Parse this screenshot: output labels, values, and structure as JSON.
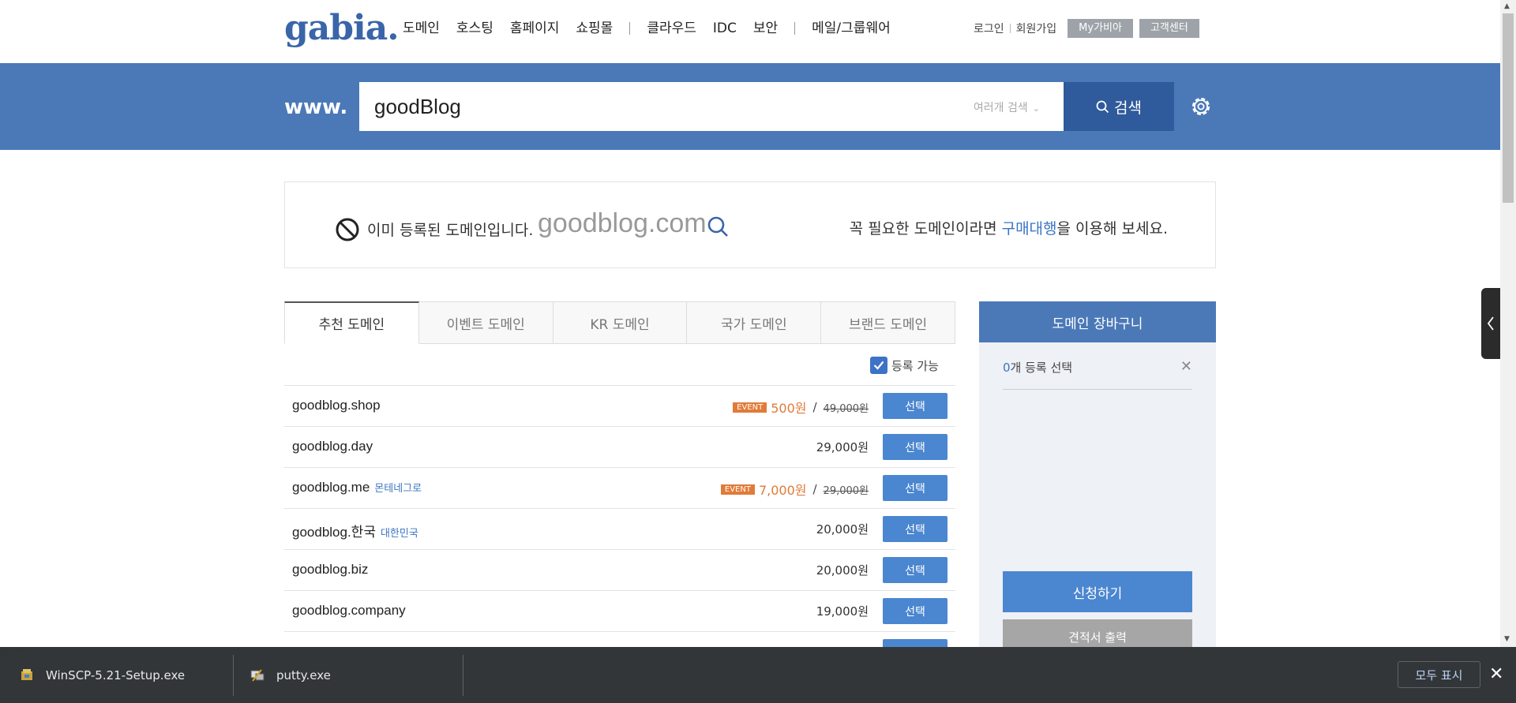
{
  "header": {
    "logo": "gabia.",
    "nav": [
      "도메인",
      "호스팅",
      "홈페이지",
      "쇼핑몰",
      "클라우드",
      "IDC",
      "보안",
      "메일/그룹웨어"
    ],
    "login": "로그인",
    "signup": "회원가입",
    "my_gabia": "My가비아",
    "support": "고객센터"
  },
  "search": {
    "prefix": "www.",
    "query": "goodBlog",
    "multi_search": "여러개 검색",
    "button": "검색"
  },
  "notice": {
    "message": "이미 등록된 도메인입니다.",
    "domain": "goodblog.com",
    "right_prefix": "꼭 필요한 도메인이라면 ",
    "right_link": "구매대행",
    "right_suffix": "을 이용해 보세요."
  },
  "tabs": [
    "추천 도메인",
    "이벤트 도메인",
    "KR 도메인",
    "국가 도메인",
    "브랜드 도메인"
  ],
  "filter": {
    "label": "등록 가능",
    "checked": true
  },
  "domains": [
    {
      "name": "goodblog.shop",
      "country": "",
      "event": "EVENT",
      "sale_price": "500원",
      "orig_price": "49,000원",
      "price": "",
      "button": "선택"
    },
    {
      "name": "goodblog.day",
      "country": "",
      "event": "",
      "sale_price": "",
      "orig_price": "",
      "price": "29,000원",
      "button": "선택"
    },
    {
      "name": "goodblog.me",
      "country": "몬테네그로",
      "event": "EVENT",
      "sale_price": "7,000원",
      "orig_price": "29,000원",
      "price": "",
      "button": "선택"
    },
    {
      "name": "goodblog.한국",
      "country": "대한민국",
      "event": "",
      "sale_price": "",
      "orig_price": "",
      "price": "20,000원",
      "button": "선택"
    },
    {
      "name": "goodblog.biz",
      "country": "",
      "event": "",
      "sale_price": "",
      "orig_price": "",
      "price": "20,000원",
      "button": "선택"
    },
    {
      "name": "goodblog.company",
      "country": "",
      "event": "",
      "sale_price": "",
      "orig_price": "",
      "price": "19,000원",
      "button": "선택"
    }
  ],
  "cart": {
    "title": "도메인 장바구니",
    "count": "0",
    "count_suffix": "개 등록 선택",
    "apply": "신청하기",
    "quote": "견적서 출력"
  },
  "downloads": {
    "items": [
      "WinSCP-5.21-Setup.exe",
      "putty.exe"
    ],
    "show_all": "모두 표시"
  },
  "colors": {
    "brand_blue": "#4b79b8",
    "button_blue": "#4b86d0",
    "event_orange": "#e07b39"
  }
}
